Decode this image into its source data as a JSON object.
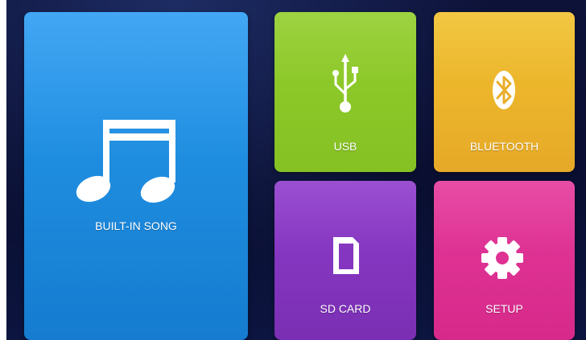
{
  "menu": {
    "tiles": [
      {
        "label": "BUILT-IN SONG",
        "icon": "music-notes-icon",
        "color": "#2196ea"
      },
      {
        "label": "USB",
        "icon": "usb-icon",
        "color": "#8cc92a"
      },
      {
        "label": "BLUETOOTH",
        "icon": "bluetooth-icon",
        "color": "#ebb42b"
      },
      {
        "label": "SD CARD",
        "icon": "sd-card-icon",
        "color": "#8536c0"
      },
      {
        "label": "SETUP",
        "icon": "gear-icon",
        "color": "#de3193"
      }
    ]
  },
  "theme": {
    "background": "#0b1034"
  }
}
